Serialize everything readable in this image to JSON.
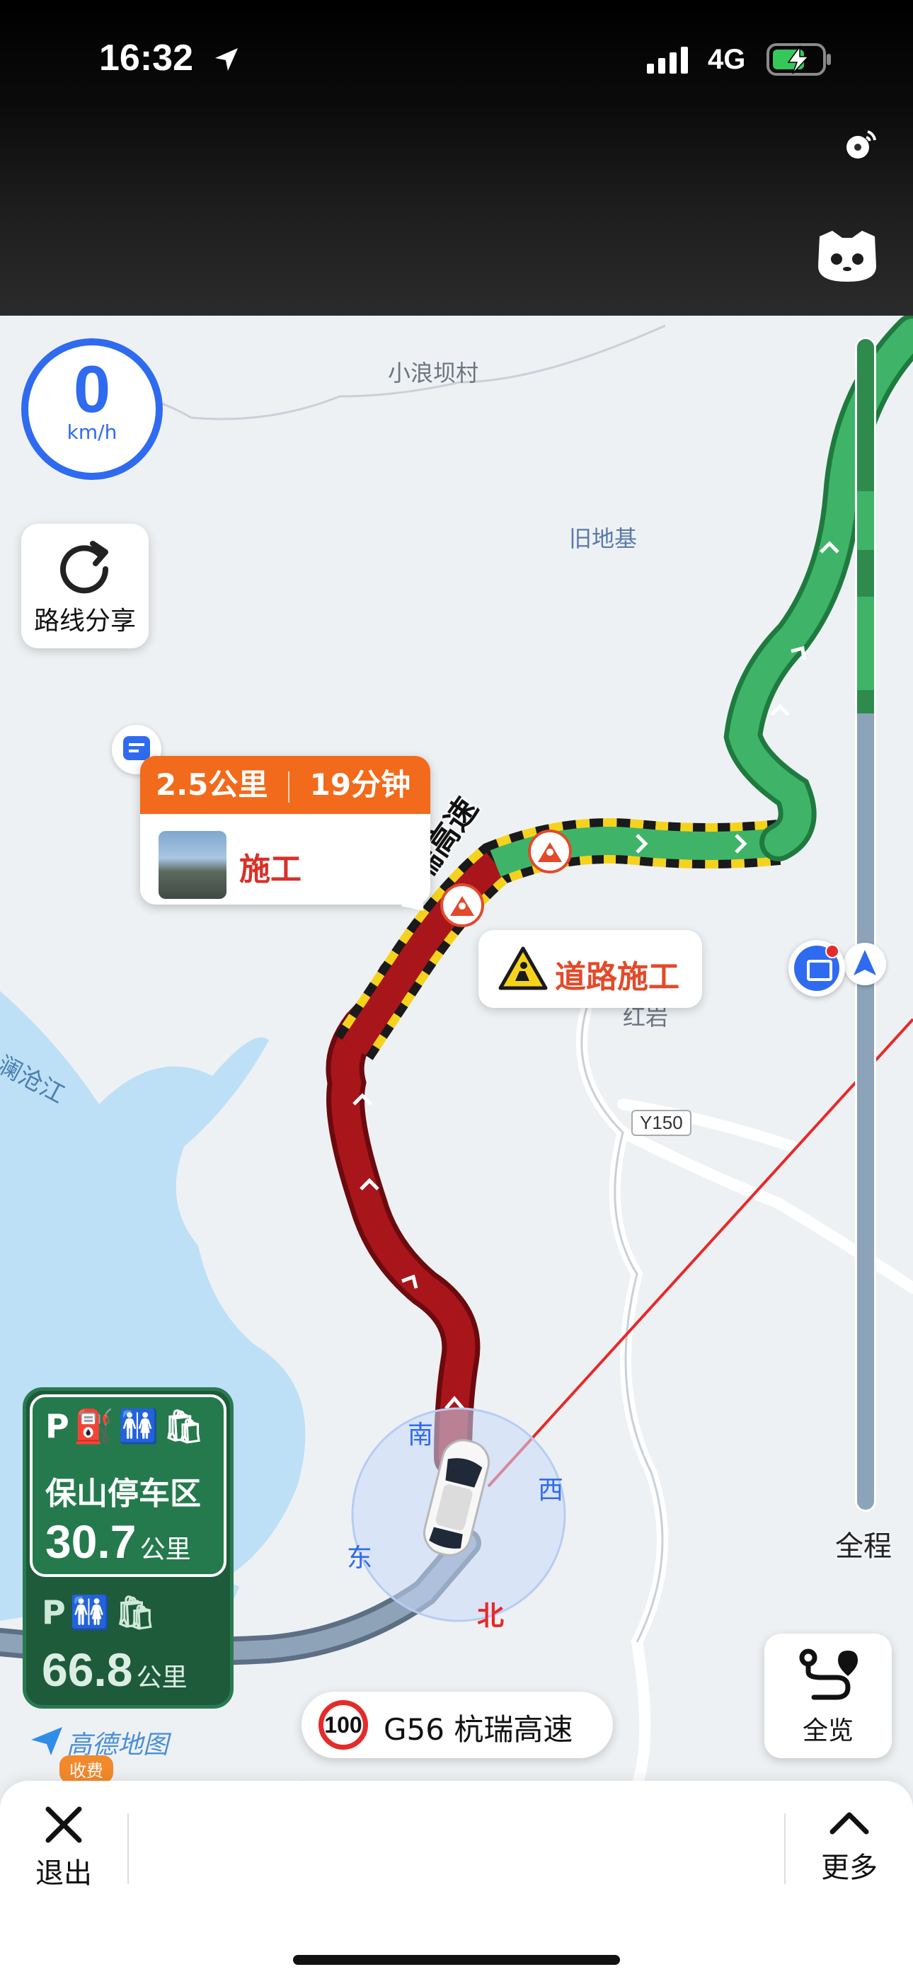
{
  "status": {
    "time": "16:32",
    "network": "4G"
  },
  "map_labels": {
    "village1": "小浪坝村",
    "village2": "旧地基",
    "village3": "红岩",
    "river": "澜沧江",
    "road_code": "Y150",
    "highway_name_on_map": "杭瑞高速"
  },
  "speed": {
    "value": "0",
    "unit": "km/h"
  },
  "route_share": {
    "label": "路线分享"
  },
  "event_card": {
    "distance": "2.5公里",
    "time": "19分钟",
    "event_label": "施工"
  },
  "road_work_tag": {
    "label": "道路施工"
  },
  "compass": {
    "south": "南",
    "west": "西",
    "east": "东",
    "north": "北"
  },
  "progress": {
    "label": "全程",
    "traveled_fraction": 0.32
  },
  "services": {
    "first": {
      "icons": "P⛽🚻🛍",
      "name": "保山停车区",
      "distance": "30.7",
      "unit": "公里"
    },
    "second": {
      "icons": "P🚻🛍",
      "distance": "66.8",
      "unit": "公里"
    }
  },
  "brand": {
    "logo_text": "高德地图",
    "toll_badge": "收费"
  },
  "road_pill": {
    "speed_limit": "100",
    "road_name": "G56 杭瑞高速"
  },
  "overview": {
    "label": "全览"
  },
  "bottom": {
    "exit_label": "退出",
    "more_label": "更多"
  },
  "colors": {
    "route_congested": "#a8151b",
    "route_clear": "#3fb468",
    "accent_blue": "#2f6bf0",
    "warning_orange": "#f26a1b",
    "service_green": "#247a4d"
  }
}
